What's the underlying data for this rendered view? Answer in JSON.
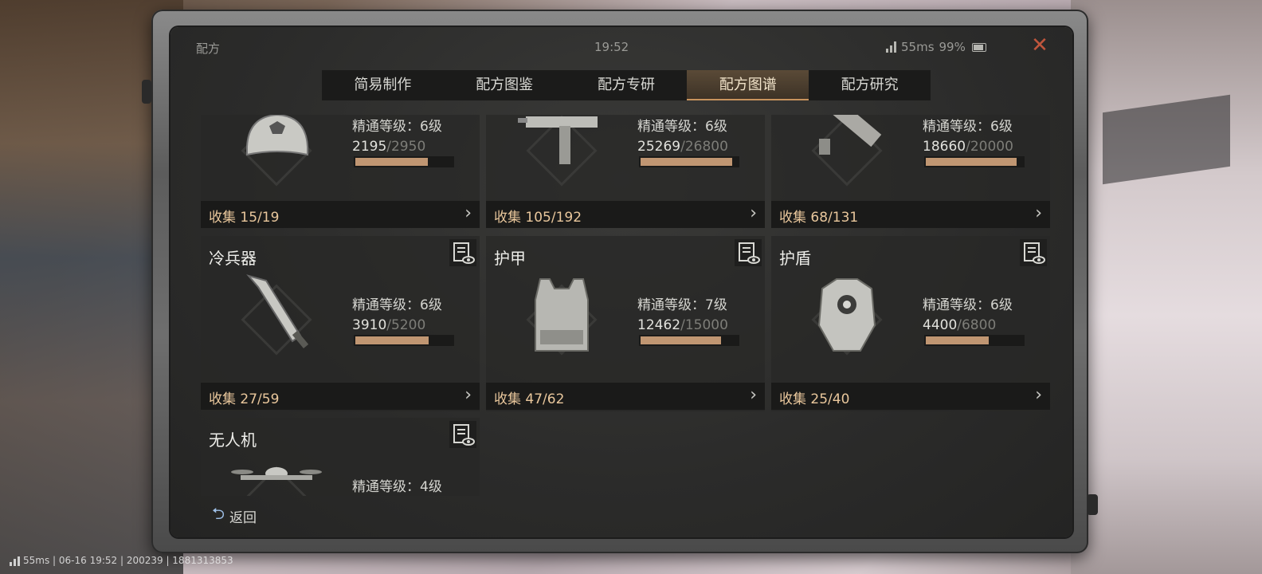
{
  "status_bar": {
    "title": "配方",
    "time": "19:52",
    "ping": "55ms",
    "battery": "99%"
  },
  "tabs": [
    {
      "label": "简易制作",
      "active": false
    },
    {
      "label": "配方图鉴",
      "active": false
    },
    {
      "label": "配方专研",
      "active": false
    },
    {
      "label": "配方图谱",
      "active": true
    },
    {
      "label": "配方研究",
      "active": false
    }
  ],
  "cards": [
    {
      "name": "",
      "icon": "cap-icon",
      "level_text": "精通等级：6级",
      "progress": "2195",
      "progress_max": "/2950",
      "progress_fraction": 0.744,
      "collect": "收集 15/19"
    },
    {
      "name": "",
      "icon": "smg-icon",
      "level_text": "精通等级：6级",
      "progress": "25269",
      "progress_max": "/26800",
      "progress_fraction": 0.943,
      "collect": "收集 105/192"
    },
    {
      "name": "",
      "icon": "launcher-icon",
      "level_text": "精通等级：6级",
      "progress": "18660",
      "progress_max": "/20000",
      "progress_fraction": 0.933,
      "collect": "收集 68/131"
    },
    {
      "name": "冷兵器",
      "icon": "blade-icon",
      "level_text": "精通等级：6级",
      "progress": "3910",
      "progress_max": "/5200",
      "progress_fraction": 0.752,
      "collect": "收集 27/59"
    },
    {
      "name": "护甲",
      "icon": "vest-icon",
      "level_text": "精通等级：7级",
      "progress": "12462",
      "progress_max": "/15000",
      "progress_fraction": 0.831,
      "collect": "收集 47/62"
    },
    {
      "name": "护盾",
      "icon": "shield-armor-icon",
      "level_text": "精通等级：6级",
      "progress": "4400",
      "progress_max": "/6800",
      "progress_fraction": 0.647,
      "collect": "收集 25/40"
    },
    {
      "name": "无人机",
      "icon": "drone-icon",
      "level_text": "精通等级：4级",
      "progress": "",
      "progress_max": "",
      "collect": ""
    }
  ],
  "back_label": "返回",
  "footer": "55ms | 06-16 19:52 | 200239 | 1881313853",
  "colors": {
    "accent": "#c09672",
    "collect_text": "#e9c79c",
    "close": "#c0563d"
  }
}
